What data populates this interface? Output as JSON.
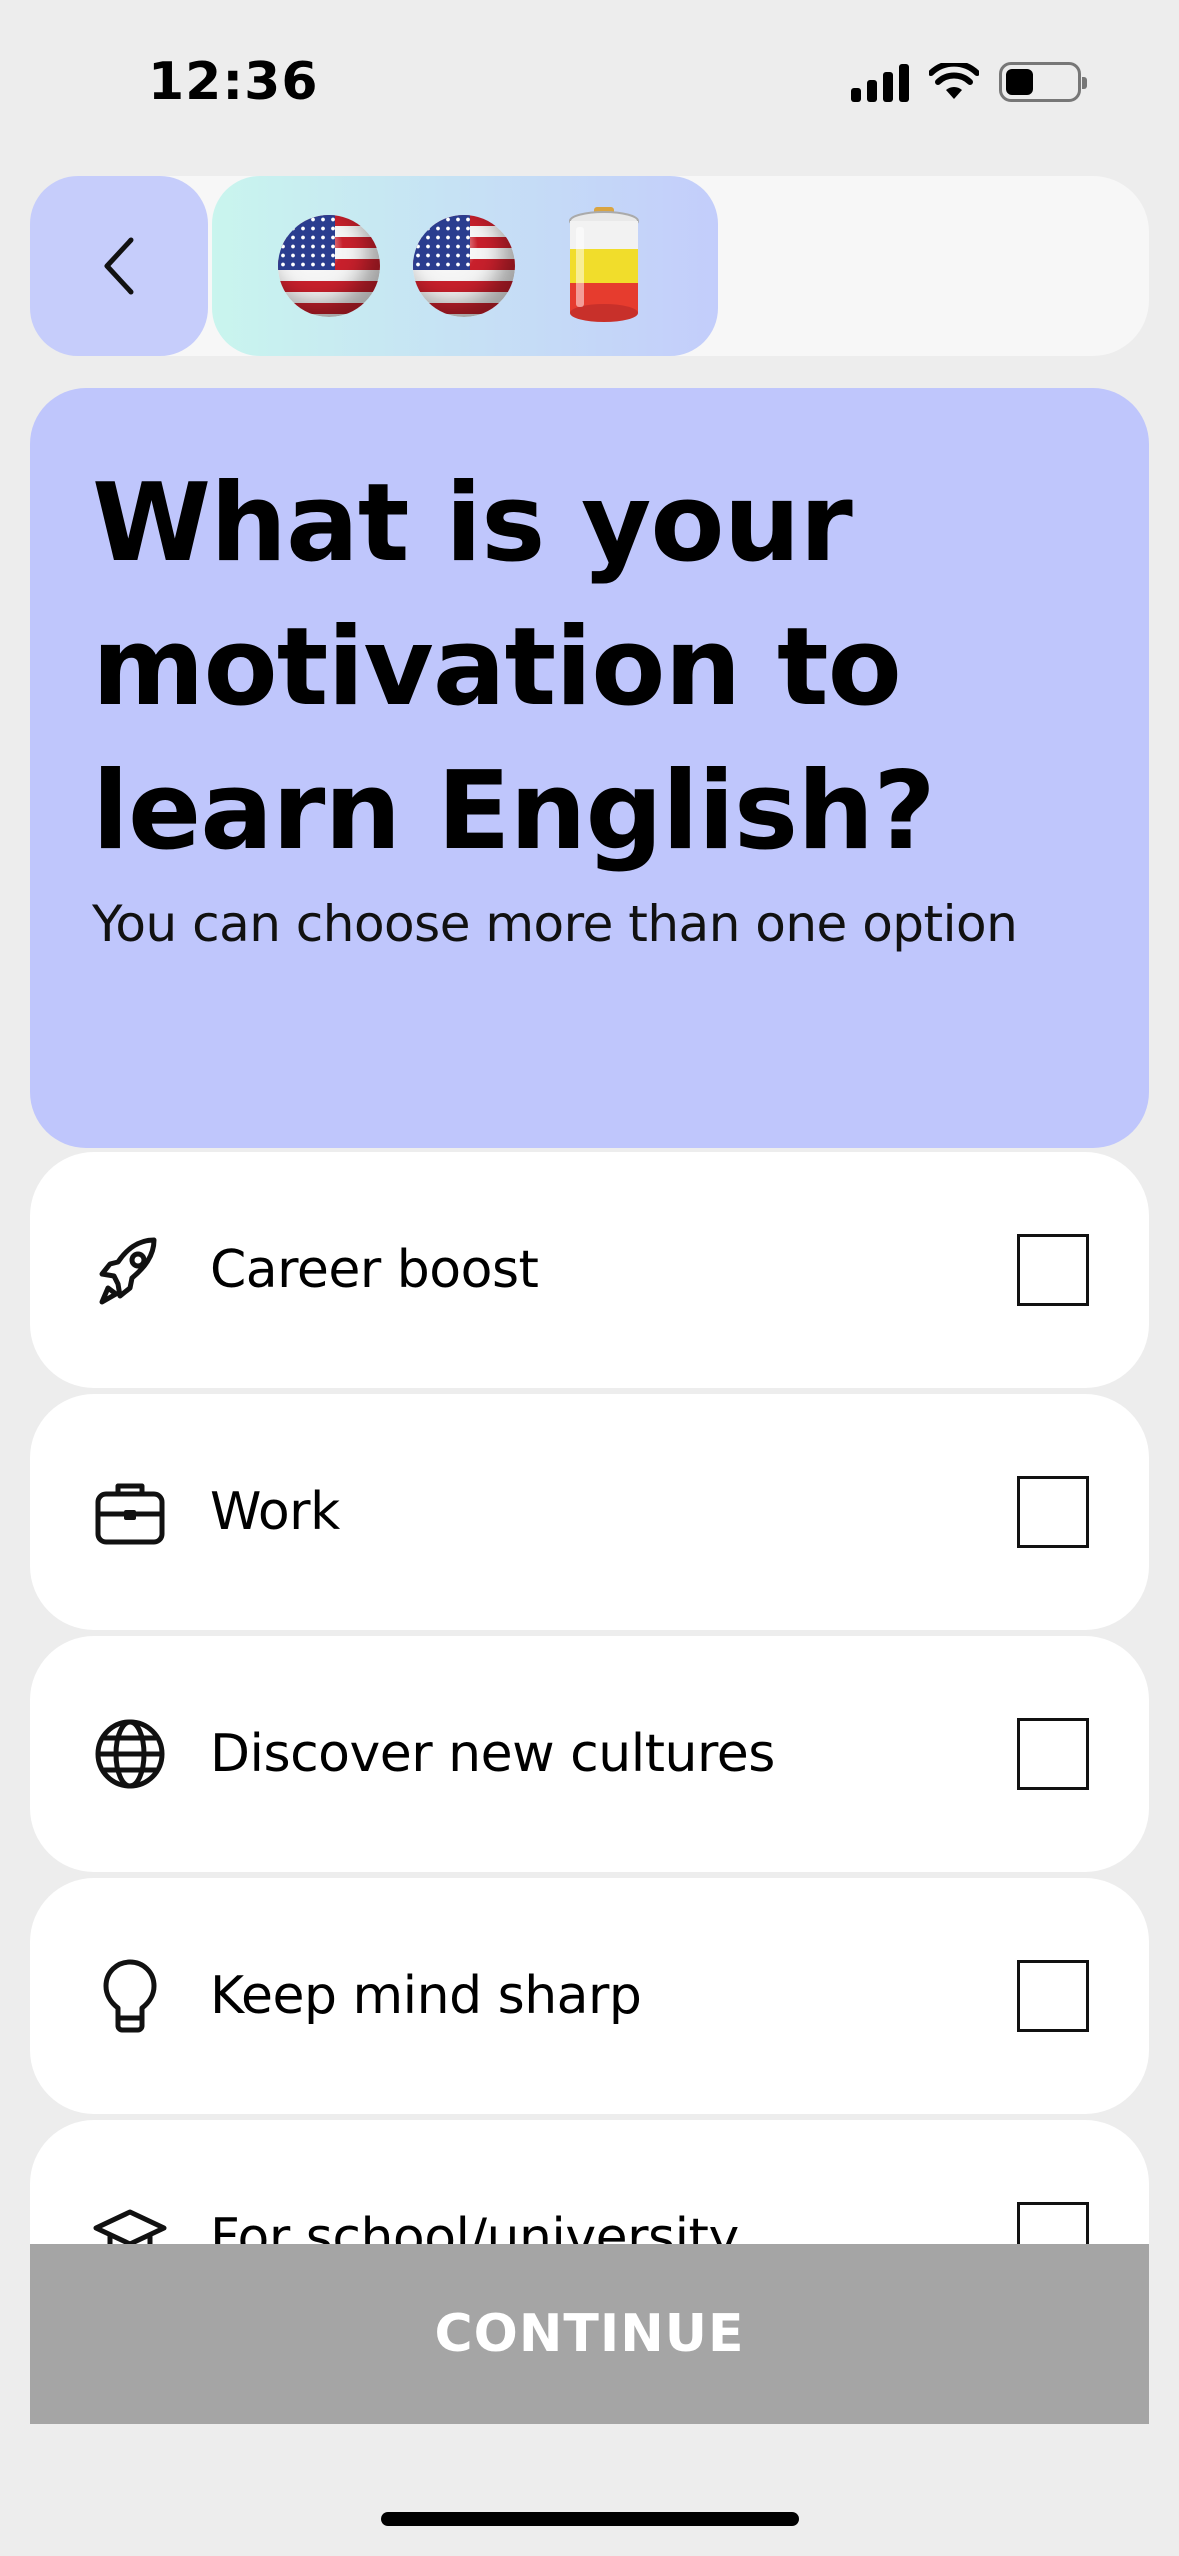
{
  "status_bar": {
    "time": "12:36",
    "icons": [
      "cellular-signal-icon",
      "wifi-icon",
      "battery-icon"
    ]
  },
  "nav": {
    "back_icon": "chevron-left-icon",
    "progress_icons": [
      "us-flag-ball-icon",
      "us-flag-ball-icon",
      "battery-emoji-icon"
    ]
  },
  "header": {
    "title": "What is your motivation to learn English?",
    "subtitle": "You can choose more than one option"
  },
  "options": [
    {
      "label": "Career boost",
      "icon": "rocket-icon",
      "checked": false
    },
    {
      "label": "Work",
      "icon": "briefcase-icon",
      "checked": false
    },
    {
      "label": "Discover new cultures",
      "icon": "globe-icon",
      "checked": false
    },
    {
      "label": "Keep mind sharp",
      "icon": "lightbulb-icon",
      "checked": false
    },
    {
      "label": "For school/university",
      "icon": "graduation-cap-icon",
      "checked": false
    }
  ],
  "footer": {
    "continue_label": "CONTINUE"
  },
  "colors": {
    "background": "#ededed",
    "header_card": "#bfc6fc",
    "back_button": "#c6cdfb",
    "continue_disabled": "#a5a5a5"
  }
}
